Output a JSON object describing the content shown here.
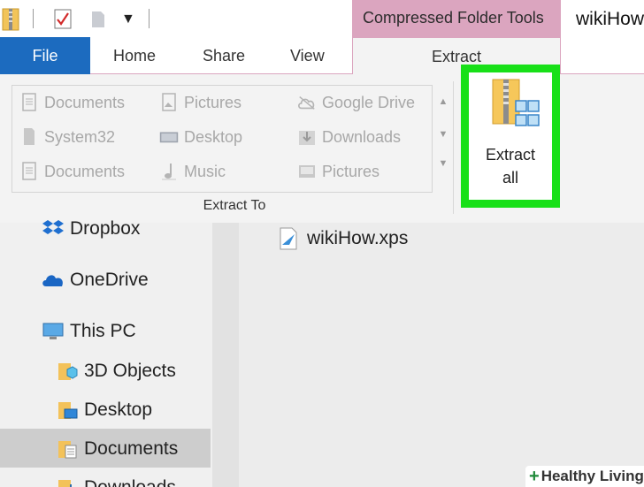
{
  "quick_access": {
    "icons": [
      "zip-folder-icon",
      "properties-check-icon",
      "new-folder-icon",
      "customize-dropdown-icon"
    ],
    "dropdown_glyph": "▼"
  },
  "title_bar": {
    "context_header": "Compressed Folder Tools",
    "window_title": "wikiHow"
  },
  "tabs": {
    "file": "File",
    "home": "Home",
    "share": "Share",
    "view": "View",
    "extract": "Extract"
  },
  "ribbon": {
    "extract_to_items": [
      [
        "Documents",
        "Pictures",
        "Google Drive"
      ],
      [
        "System32",
        "Desktop",
        "Downloads"
      ],
      [
        "Documents",
        "Music",
        "Pictures"
      ]
    ],
    "gallery_scroll": [
      "▲",
      "▼",
      "▼"
    ],
    "group_label": "Extract To",
    "extract_all_label": [
      "Extract",
      "all"
    ],
    "highlight_color": "#18e018"
  },
  "nav_pane": {
    "items": [
      "Dropbox",
      "OneDrive",
      "This PC",
      "3D Objects",
      "Desktop",
      "Documents",
      "Downloads"
    ],
    "selected": "Documents"
  },
  "content": {
    "files": [
      "wikiHow.xps"
    ]
  },
  "watermark": {
    "text": "Healthy Living",
    "plus": "+"
  },
  "colors": {
    "file_tab": "#1c6bbf",
    "context_tab": "#dba5bf",
    "ribbon_bg": "#f3f3f3"
  }
}
